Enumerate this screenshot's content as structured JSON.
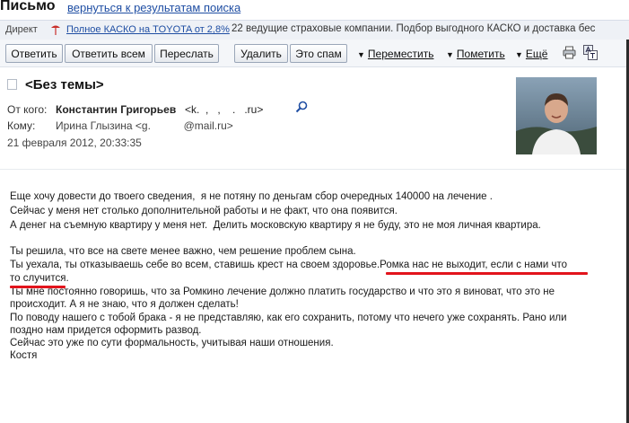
{
  "page": {
    "title": "Письмо",
    "back_link": "вернуться к результатам поиска"
  },
  "direct": {
    "label": "Директ",
    "ad_link": "Полное КАСКО на TOYOTA от 2,8%",
    "ad_text": "22 ведущие страховые компании. Подбор выгодного КАСКО и доставка бес"
  },
  "toolbar": {
    "reply": "Ответить",
    "reply_all": "Ответить всем",
    "forward": "Переслать",
    "delete": "Удалить",
    "spam": "Это спам",
    "move": "Переместить",
    "mark": "Пометить",
    "more": "Ещё"
  },
  "header": {
    "subject": "<Без темы>",
    "from_label": "От кого:",
    "from_name": "Константин Григорьев",
    "from_email": "<k.  ,   ,    .   .ru>",
    "to_label": "Кому:",
    "to_value": "Ирина Глызина <g.           @mail.ru>",
    "date": "21 февраля 2012, 20:33:35"
  },
  "body": {
    "lines": [
      "Еще хочу довести до твоего сведения,  я не потяну по деньгам сбор очередных 140000 на лечение .",
      "Сейчас у меня нет столько дополнительной работы и не факт, что она появится.",
      "А денег на съемную квартиру у меня нет.  Делить московскую квартиру я не буду, это не моя личная квартира.",
      "",
      "Ты решила, что все на свете менее важно, чем решение проблем сына.",
      "Ты уехала, ты отказываешь себе во всем, ставишь крест на своем здоровье.Ромка нас не выходит, если с нами что",
      "то случится.",
      "Ты мне постоянно говоришь, что за Ромкино лечение должно платить государство и что это я виноват, что это не",
      "происходит. А я не знаю, что я должен сделать!",
      "По поводу нашего с тобой брака - я не представляю, как его сохранить, потому что нечего уже сохранять. Рано или",
      "поздно нам придется оформить развод.",
      "Сейчас это уже по сути формальность, учитывая наши отношения.",
      "Костя"
    ]
  },
  "colors": {
    "link": "#1f4ea3",
    "underline_highlight": "#e2141c",
    "toolbar_bg": "#f4f6f9"
  },
  "icons": [
    "direct-ad-icon",
    "print-icon",
    "translate-icon",
    "search-icon",
    "flag-icon",
    "avatar-photo"
  ]
}
